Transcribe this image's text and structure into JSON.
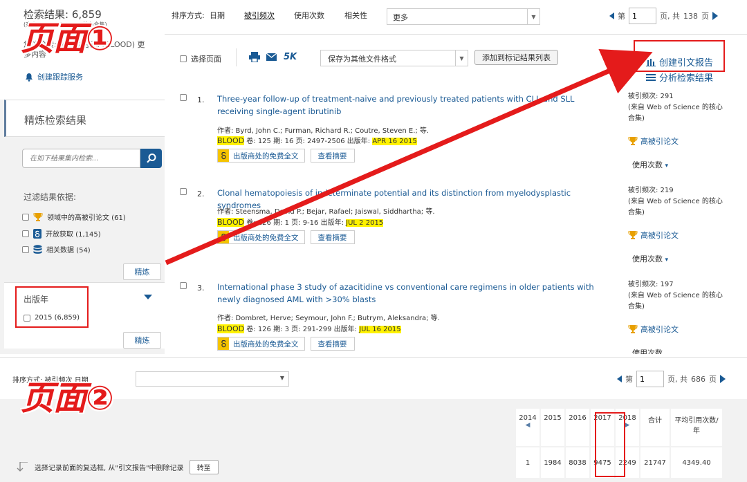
{
  "page1": {
    "sidebar": {
      "result_count": "检索结果: 6,859",
      "result_source": "(来自 Web of Science 核心合集)",
      "journal_query_1": "您的检索: 出版物名称: (BLOOD) 更",
      "journal_query_2": "多内容",
      "track_service": "创建跟踪服务",
      "refine_title": "精炼检索结果",
      "search_placeholder": "在如下结果集内检索...",
      "filter_label": "过滤结果依据:",
      "filters": [
        {
          "label": "领域中的高被引论文 (61)",
          "icon": "trophy-icon"
        },
        {
          "label": "开放获取 (1,145)",
          "icon": "open-access-icon"
        },
        {
          "label": "相关数据 (54)",
          "icon": "database-icon"
        }
      ],
      "refine_button": "精炼",
      "year_title": "出版年",
      "year_item": "2015 (6,859)",
      "refine_button_2": "精炼"
    },
    "toolbar": {
      "sort_label": "排序方式:",
      "sort_options": [
        "日期",
        "被引频次",
        "使用次数",
        "相关性"
      ],
      "more": "更多",
      "page_prefix": "第",
      "page_value": "1",
      "page_suffix": "页, 共",
      "total_pages": "138",
      "page_unit": "页"
    },
    "actions": {
      "select_page": "选择页面",
      "fivek": "5K",
      "save_format": "保存为其他文件格式",
      "add_mark": "添加到标记结果列表",
      "cite_report": "创建引文报告",
      "analyze": "分析检索结果"
    },
    "records": [
      {
        "num": "1.",
        "title": "Three-year follow-up of treatment-naive and previously treated patients with CLL and SLL receiving single-agent ibrutinib",
        "authors": "作者: Byrd, John C.; Furman, Richard R.; Coutre, Steven E.; 等.",
        "journal": "BLOOD",
        "src": "卷: 125  期: 16  页: 2497-2506  出版年:",
        "date": "APR 16 2015",
        "oa_label": "出版商处的免费全文",
        "abs_label": "查看摘要",
        "cites": "被引频次: 291",
        "cites_src": "(来自 Web of Science 的核心合集)",
        "hot": "高被引论文",
        "usage": "使用次数"
      },
      {
        "num": "2.",
        "title": "Clonal hematopoiesis of indeterminate potential and its distinction from myelodysplastic syndromes",
        "authors": "作者: Steensma, David P.; Bejar, Rafael; Jaiswal, Siddhartha; 等.",
        "journal": "BLOOD",
        "src": "卷: 126  期: 1  页: 9-16  出版年:",
        "date": "JUL 2 2015",
        "oa_label": "出版商处的免费全文",
        "abs_label": "查看摘要",
        "cites": "被引频次: 219",
        "cites_src": "(来自 Web of Science 的核心合集)",
        "hot": "高被引论文",
        "usage": "使用次数"
      },
      {
        "num": "3.",
        "title": "International phase 3 study of azacitidine vs conventional care regimens in older patients with newly diagnosed AML with >30% blasts",
        "authors": "作者: Dombret, Herve; Seymour, John F.; Butrym, Aleksandra; 等.",
        "journal": "BLOOD",
        "src": "卷: 126  期: 3  页: 291-299  出版年:",
        "date": "JUL 16 2015",
        "oa_label": "出版商处的免费全文",
        "abs_label": "查看摘要",
        "cites": "被引频次: 197",
        "cites_src": "(来自 Web of Science 的核心合集)",
        "hot": "高被引论文",
        "usage": "使用次数"
      }
    ]
  },
  "labels": {
    "page1": "页面①",
    "page2": "页面②"
  },
  "page2": {
    "sort_label": "排序方式: 被引频次    日期",
    "page_prefix": "第",
    "page_value": "1",
    "page_suffix": "页, 共",
    "total_pages": "686",
    "page_unit": "页",
    "bottom_note": "选择记录前面的复选框, 从\"引文报告\"中删除记录",
    "goto_button": "转至",
    "table_headers": [
      "2014",
      "2015",
      "2016",
      "2017",
      "2018",
      "合计",
      "平均引用次数/年"
    ],
    "table_values": [
      "1",
      "1984",
      "8038",
      "9475",
      "2249",
      "21747",
      "4349.40"
    ]
  },
  "colors": {
    "accent": "#1a5a94",
    "highlight": "#fff200",
    "annotation_red": "#e41b1b",
    "oa_yellow": "#f5c400"
  }
}
